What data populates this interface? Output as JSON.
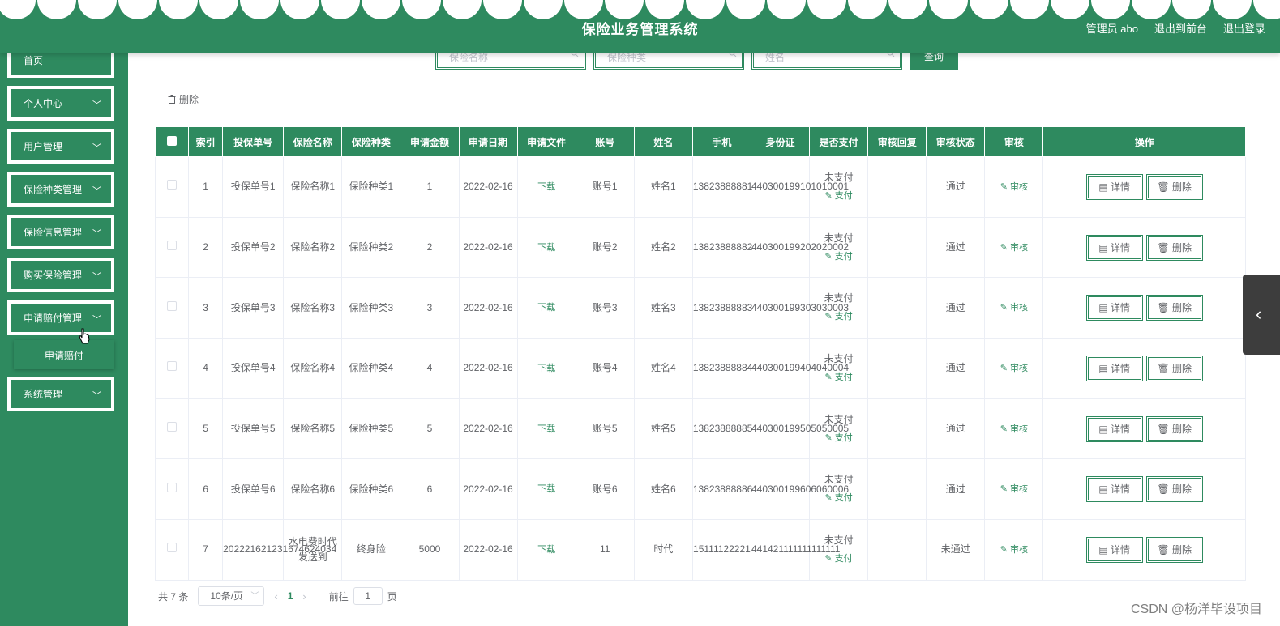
{
  "header": {
    "title": "保险业务管理系统",
    "admin": "管理员 abo",
    "front_link": "退出到前台",
    "logout_link": "退出登录"
  },
  "sidebar": {
    "items": [
      {
        "label": "首页",
        "has_chevron": false
      },
      {
        "label": "个人中心",
        "has_chevron": true
      },
      {
        "label": "用户管理",
        "has_chevron": true
      },
      {
        "label": "保险种类管理",
        "has_chevron": true
      },
      {
        "label": "保险信息管理",
        "has_chevron": true
      },
      {
        "label": "购买保险管理",
        "has_chevron": true
      },
      {
        "label": "申请赔付管理",
        "has_chevron": true
      },
      {
        "label": "系统管理",
        "has_chevron": true
      }
    ],
    "submenu_label": "申请赔付"
  },
  "search": {
    "name_placeholder": "保险名称",
    "type_placeholder": "保险种类",
    "person_placeholder": "姓名",
    "button": "查询"
  },
  "toolbar": {
    "delete": "删除"
  },
  "table": {
    "headers": [
      "索引",
      "投保单号",
      "保险名称",
      "保险种类",
      "申请金额",
      "申请日期",
      "申请文件",
      "账号",
      "姓名",
      "手机",
      "身份证",
      "是否支付",
      "审核回复",
      "审核状态",
      "审核",
      "操作"
    ],
    "download_label": "下载",
    "pay_label": "支付",
    "audit_label": "审核",
    "detail_label": "详情",
    "delete_label": "删除",
    "rows": [
      {
        "index": "1",
        "order": "投保单号1",
        "name": "保险名称1",
        "type": "保险种类1",
        "amount": "1",
        "date": "2022-02-16",
        "account": "账号1",
        "person": "姓名1",
        "phone": "13823888881",
        "id": "440300199101010001",
        "paid": "未支付",
        "reply": "",
        "status": "通过"
      },
      {
        "index": "2",
        "order": "投保单号2",
        "name": "保险名称2",
        "type": "保险种类2",
        "amount": "2",
        "date": "2022-02-16",
        "account": "账号2",
        "person": "姓名2",
        "phone": "13823888882",
        "id": "440300199202020002",
        "paid": "未支付",
        "reply": "",
        "status": "通过"
      },
      {
        "index": "3",
        "order": "投保单号3",
        "name": "保险名称3",
        "type": "保险种类3",
        "amount": "3",
        "date": "2022-02-16",
        "account": "账号3",
        "person": "姓名3",
        "phone": "13823888883",
        "id": "440300199303030003",
        "paid": "未支付",
        "reply": "",
        "status": "通过"
      },
      {
        "index": "4",
        "order": "投保单号4",
        "name": "保险名称4",
        "type": "保险种类4",
        "amount": "4",
        "date": "2022-02-16",
        "account": "账号4",
        "person": "姓名4",
        "phone": "13823888884",
        "id": "440300199404040004",
        "paid": "未支付",
        "reply": "",
        "status": "通过"
      },
      {
        "index": "5",
        "order": "投保单号5",
        "name": "保险名称5",
        "type": "保险种类5",
        "amount": "5",
        "date": "2022-02-16",
        "account": "账号5",
        "person": "姓名5",
        "phone": "13823888885",
        "id": "440300199505050005",
        "paid": "未支付",
        "reply": "",
        "status": "通过"
      },
      {
        "index": "6",
        "order": "投保单号6",
        "name": "保险名称6",
        "type": "保险种类6",
        "amount": "6",
        "date": "2022-02-16",
        "account": "账号6",
        "person": "姓名6",
        "phone": "13823888886",
        "id": "440300199606060006",
        "paid": "未支付",
        "reply": "",
        "status": "通过"
      },
      {
        "index": "7",
        "order": "202221621231674624034",
        "name": "水电费时代发送到",
        "type": "终身险",
        "amount": "5000",
        "date": "2022-02-16",
        "account": "11",
        "person": "时代",
        "phone": "15111122221",
        "id": "441421111111111111",
        "paid": "未支付",
        "reply": "",
        "status": "未通过"
      }
    ]
  },
  "pagination": {
    "total": "共 7 条",
    "page_size": "10条/页",
    "current_page": "1",
    "goto_prefix": "前往",
    "goto_value": "1",
    "goto_suffix": "页"
  },
  "watermark": "CSDN @杨洋毕设项目",
  "colors": {
    "primary": "#2e8a5f",
    "side_tab": "#3d3d3d"
  }
}
